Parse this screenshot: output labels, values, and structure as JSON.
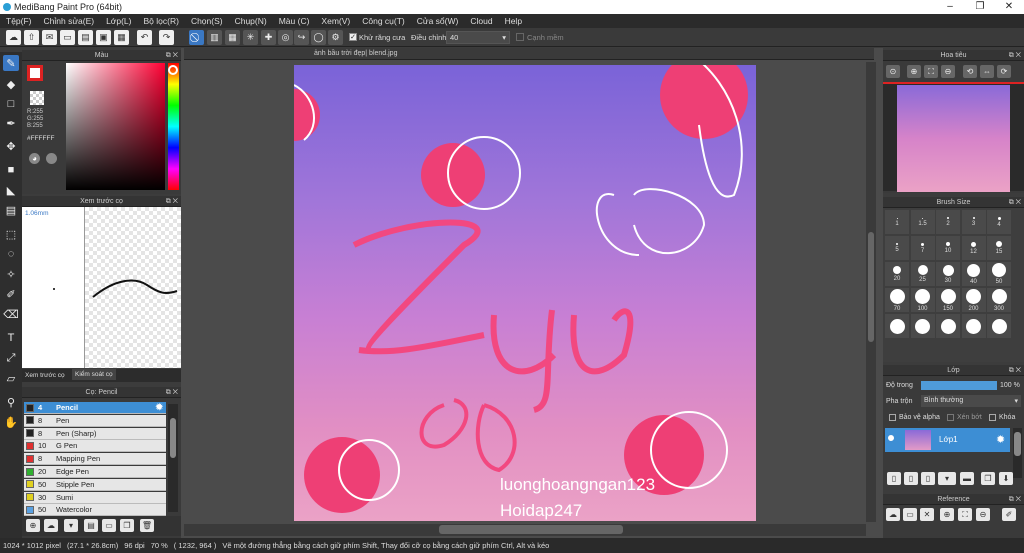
{
  "window": {
    "title": "MediBang Paint Pro (64bit)",
    "min": "–",
    "restore": "❐",
    "close": "✕"
  },
  "menu": [
    "Tệp(F)",
    "Chỉnh sửa(E)",
    "Lớp(L)",
    "Bộ lọc(R)",
    "Chọn(S)",
    "Chụp(N)",
    "Màu (C)",
    "Xem(V)",
    "Công cụ(T)",
    "Cửa sổ(W)",
    "Cloud",
    "Help"
  ],
  "toolbar": {
    "antialias_label": "Khử răng cưa",
    "adjust_label": "Điều chỉnh",
    "adjust_value": "40",
    "soft_edge_label": "Cạnh mềm"
  },
  "color_panel": {
    "title": "Màu",
    "r": "R:255",
    "g": "G:255",
    "b": "B:255",
    "hex": "#FFFFFF"
  },
  "brush_preview": {
    "title": "Xem trước cọ",
    "size": "1.06mm",
    "tab1": "Xem trước cọ",
    "tab2": "Kiểm soát cọ"
  },
  "brush_list": {
    "title": "Cọ: Pencil",
    "items": [
      {
        "num": "4",
        "name": "Pencil",
        "color": "#222222",
        "selected": true
      },
      {
        "num": "8",
        "name": "Pen",
        "color": "#222222"
      },
      {
        "num": "8",
        "name": "Pen (Sharp)",
        "color": "#222222"
      },
      {
        "num": "10",
        "name": "G Pen",
        "color": "#e03030"
      },
      {
        "num": "8",
        "name": "Mapping Pen",
        "color": "#e03030"
      },
      {
        "num": "20",
        "name": "Edge Pen",
        "color": "#30b030"
      },
      {
        "num": "50",
        "name": "Stipple Pen",
        "color": "#e0d020"
      },
      {
        "num": "30",
        "name": "Sumi",
        "color": "#e0d020"
      },
      {
        "num": "50",
        "name": "Watercolor",
        "color": "#5aa0e0"
      }
    ]
  },
  "canvas": {
    "tab": "ảnh bầu trời đẹp| blend.jpg",
    "watermark1": "luonghoangngan123",
    "watermark2": "Hoidap247",
    "drawn_text": "Zui"
  },
  "navigator": {
    "title": "Hoa tiêu"
  },
  "brush_size": {
    "title": "Brush Size",
    "sizes": [
      "1",
      "1.5",
      "2",
      "3",
      "4",
      "5",
      "7",
      "10",
      "12",
      "15",
      "20",
      "25",
      "30",
      "40",
      "50",
      "70",
      "100",
      "150",
      "200",
      "300"
    ]
  },
  "layer_panel": {
    "title": "Lớp",
    "opacity_label": "Độ trong",
    "opacity_value": "100 %",
    "blend_label": "Pha trộn",
    "blend_value": "Bình thường",
    "protect_alpha": "Bảo vệ alpha",
    "clip": "Xén bớt",
    "lock": "Khóa",
    "layer_name": "Lớp1"
  },
  "reference": {
    "title": "Reference"
  },
  "status": {
    "size": "1024 * 1012 pixel",
    "physical": "(27.1 * 26.8cm)",
    "dpi": "96 dpi",
    "zoom": "70 %",
    "coords": "( 1232, 964 )",
    "hint": "Vẽ một đường thẳng bằng cách giữ phím Shift, Thay đổi cỡ cọ bằng cách giữ phím Ctrl, Alt và kéo"
  },
  "colors": {
    "accent": "#3a78c4",
    "selected_row": "#3d8ed4",
    "pink": "#f0457a"
  }
}
